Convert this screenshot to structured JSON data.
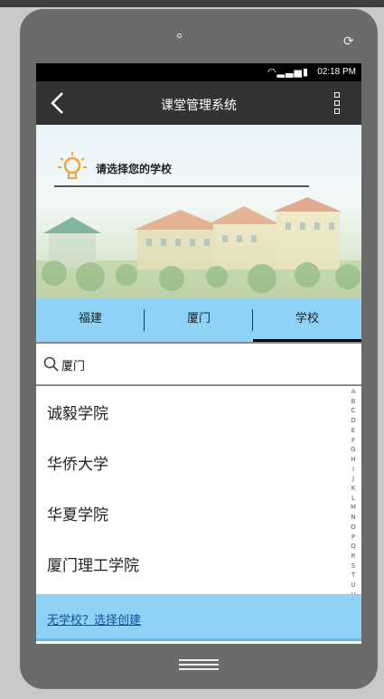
{
  "status": {
    "time": "02:18 PM",
    "wifi_icon": "wifi-icon",
    "signal_icon": "signal-icon",
    "battery_icon": "battery-icon"
  },
  "appbar": {
    "title": "课堂管理系统",
    "back_icon": "back-arrow-icon",
    "menu_icon": "overflow-menu-icon"
  },
  "banner": {
    "prompt": "请选择您的学校",
    "icon": "lightbulb-icon"
  },
  "tabs": [
    {
      "label": "福建",
      "active": false
    },
    {
      "label": "厦门",
      "active": false
    },
    {
      "label": "学校",
      "active": true
    }
  ],
  "search": {
    "value": "厦门",
    "icon": "search-icon"
  },
  "schools": [
    "诚毅学院",
    "华侨大学",
    "华夏学院",
    "厦门理工学院"
  ],
  "index_letters": [
    "A",
    "B",
    "C",
    "D",
    "E",
    "F",
    "G",
    "H",
    "I",
    "J",
    "K",
    "L",
    "M",
    "N",
    "O",
    "P",
    "Q",
    "R",
    "S",
    "T",
    "U",
    "V",
    "W",
    "X",
    "Y"
  ],
  "create_link": "无学校？选择创建",
  "colors": {
    "accent": "#8ed3f5",
    "appbar": "#333333",
    "link": "#1a4aa0"
  }
}
